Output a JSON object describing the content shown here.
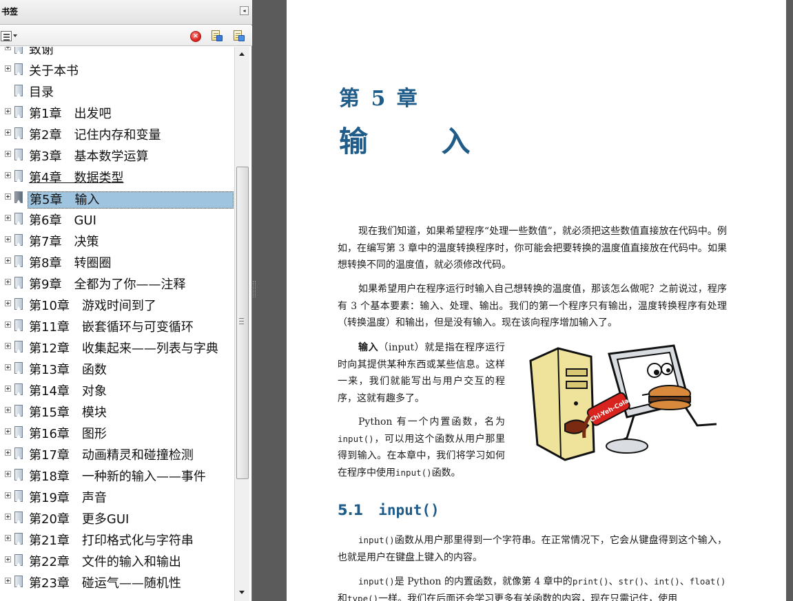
{
  "bookmarks_panel": {
    "title": "书签",
    "collapse_glyph": "◂",
    "toolbar": {
      "options_icon": "options-menu-icon",
      "delete_icon": "delete-bookmark-icon",
      "delete_glyph": "×",
      "new_icon": "new-bookmark-icon",
      "expand_icon": "expand-bookmark-icon"
    },
    "items": [
      {
        "label": "致谢",
        "expandable": true,
        "state": "normal"
      },
      {
        "label": "关于本书",
        "expandable": true,
        "state": "normal"
      },
      {
        "label": "目录",
        "expandable": false,
        "state": "normal"
      },
      {
        "label": "第1章　出发吧",
        "expandable": true,
        "state": "normal"
      },
      {
        "label": "第2章　记住内存和变量",
        "expandable": true,
        "state": "normal"
      },
      {
        "label": "第3章　基本数学运算",
        "expandable": true,
        "state": "normal"
      },
      {
        "label": "第4章　数据类型",
        "expandable": true,
        "state": "underline"
      },
      {
        "label": "第5章　输入",
        "expandable": true,
        "state": "selected"
      },
      {
        "label": "第6章　GUI",
        "expandable": true,
        "state": "normal"
      },
      {
        "label": "第7章　决策",
        "expandable": true,
        "state": "normal"
      },
      {
        "label": "第8章　转圈圈",
        "expandable": true,
        "state": "normal"
      },
      {
        "label": "第9章　全都为了你——注释",
        "expandable": true,
        "state": "normal"
      },
      {
        "label": "第10章　游戏时间到了",
        "expandable": true,
        "state": "normal"
      },
      {
        "label": "第11章　嵌套循环与可变循环",
        "expandable": true,
        "state": "normal"
      },
      {
        "label": "第12章　收集起来——列表与字典",
        "expandable": true,
        "state": "normal"
      },
      {
        "label": "第13章　函数",
        "expandable": true,
        "state": "normal"
      },
      {
        "label": "第14章　对象",
        "expandable": true,
        "state": "normal"
      },
      {
        "label": "第15章　模块",
        "expandable": true,
        "state": "normal"
      },
      {
        "label": "第16章　图形",
        "expandable": true,
        "state": "normal"
      },
      {
        "label": "第17章　动画精灵和碰撞检测",
        "expandable": true,
        "state": "normal"
      },
      {
        "label": "第18章　一种新的输入——事件",
        "expandable": true,
        "state": "normal"
      },
      {
        "label": "第19章　声音",
        "expandable": true,
        "state": "normal"
      },
      {
        "label": "第20章　更多GUI",
        "expandable": true,
        "state": "normal"
      },
      {
        "label": "第21章　打印格式化与字符串",
        "expandable": true,
        "state": "normal"
      },
      {
        "label": "第22章　文件的输入和输出",
        "expandable": true,
        "state": "normal"
      },
      {
        "label": "第23章　碰运气——随机性",
        "expandable": true,
        "state": "normal"
      }
    ]
  },
  "document": {
    "chapter_label": "第 5 章",
    "chapter_title_1": "输",
    "chapter_title_2": "入",
    "p1": "现在我们知道，如果希望程序“处理一些数值”，就必须把这些数值直接放在代码中。例如，在编写第 3 章中的温度转换程序时，你可能会把要转换的温度值直接放在代码中。如果想转换不同的温度值，就必须修改代码。",
    "p2": "如果希望用户在程序运行时输入自己想转换的温度值，那该怎么做呢？之前说过，程序有 3 个基本要素：输入、处理、输出。我们的第一个程序只有输出，温度转换程序有处理（转换温度）和输出，但是没有输入。现在该向程序增加输入了。",
    "p3_bold": "输入",
    "p3_rest": "（input）就是指在程序运行时向其提供某种东西或某些信息。这样一来，我们就能写出与用户交互的程序，这就有趣多了。",
    "p4_a": "Python 有一个内置函数，名为",
    "p4_code": "input()",
    "p4_b": "，可以用这个函数从用户那里得到输入。在本章中，我们将学习如何在程序中使用",
    "p4_code2": "input()",
    "p4_c": "函数。",
    "section_num": "5.1",
    "section_title": "input()",
    "p5_code": "input()",
    "p5_rest": "函数从用户那里得到一个字符串。在正常情况下，它会从键盘得到这个输入，也就是用户在键盘上键入的内容。",
    "p6_code": "input()",
    "p6_a": "是 Python 的内置函数，就像第 4 章中的",
    "p6_code2": "print()",
    "p6_sep1": "、",
    "p6_code3": "str()",
    "p6_sep2": "、",
    "p6_code4": "int()",
    "p6_sep3": "、",
    "p6_code5": "float()",
    "p6_b": "和",
    "p6_code6": "type()",
    "p6_c": "一样。我们在后面还会学习更多有关函数的内容，现在只需记住，使用",
    "illustration": {
      "can_text": "Chi-Yeh-Cola",
      "icon": "computer-eating-illustration"
    }
  },
  "colors": {
    "heading_blue": "#1f5c8a",
    "selection": "#9ec4e0",
    "chrome_gray": "#5b5b5b"
  }
}
